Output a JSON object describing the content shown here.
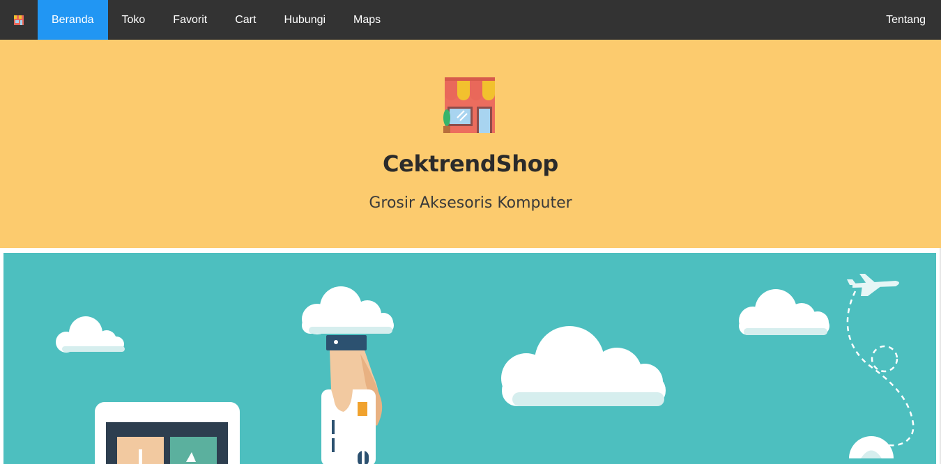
{
  "navbar": {
    "logo_icon": "shop-icon",
    "items": [
      {
        "label": "Beranda",
        "active": true
      },
      {
        "label": "Toko",
        "active": false
      },
      {
        "label": "Favorit",
        "active": false
      },
      {
        "label": "Cart",
        "active": false
      },
      {
        "label": "Hubungi",
        "active": false
      },
      {
        "label": "Maps",
        "active": false
      }
    ],
    "right_item": {
      "label": "Tentang"
    },
    "active_color": "#2196F3",
    "background": "#333333"
  },
  "hero": {
    "icon": "storefront-icon",
    "title": "CektrendShop",
    "subtitle": "Grosir Aksesoris Komputer",
    "background": "#FCCB6E"
  },
  "banner": {
    "illustration": "online-shopping-illustration",
    "background": "#4DBFBF"
  }
}
